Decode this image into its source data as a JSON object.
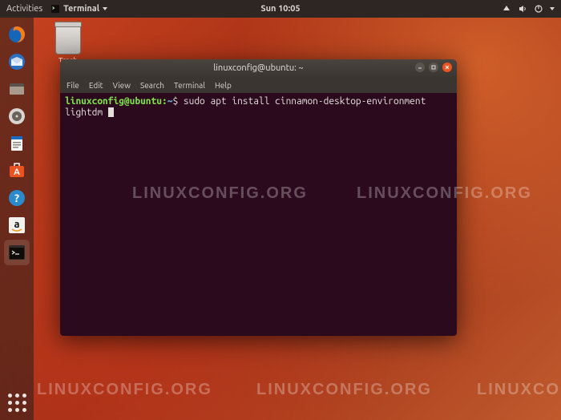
{
  "topbar": {
    "activities": "Activities",
    "app_name": "Terminal",
    "clock": "Sun 10:05"
  },
  "desktop": {
    "trash_label": "Trash"
  },
  "dock": {
    "items": [
      "firefox",
      "thunderbird",
      "files",
      "rhythmbox",
      "writer",
      "software",
      "help",
      "amazon",
      "terminal"
    ]
  },
  "window": {
    "title": "linuxconfig@ubuntu: ~",
    "menus": [
      "File",
      "Edit",
      "View",
      "Search",
      "Terminal",
      "Help"
    ]
  },
  "terminal": {
    "user_host": "linuxconfig@ubuntu",
    "sep": ":",
    "path": "~",
    "prompt_char": "$",
    "command": "sudo apt install cinnamon-desktop-environment lightdm"
  },
  "watermark": "LINUXCONFIG.ORG"
}
